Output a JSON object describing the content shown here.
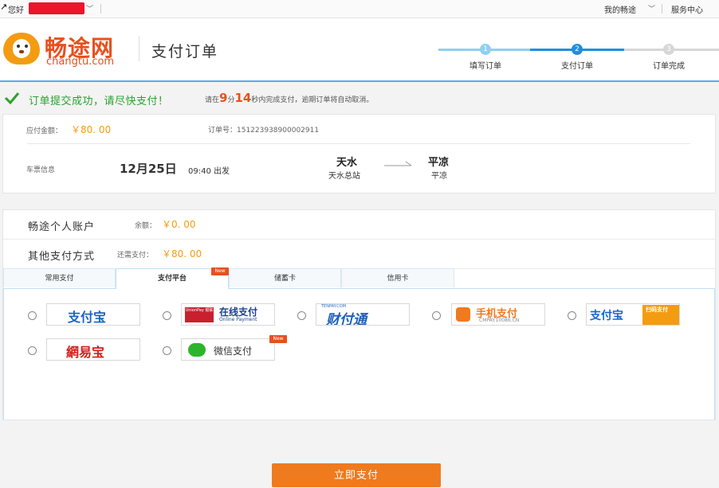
{
  "topbar": {
    "greeting": "您好",
    "my_changtu": "我的畅途",
    "service_center": "服务中心"
  },
  "brand": {
    "name_cn": "畅途网",
    "name_en": "changtu.com",
    "page_title": "支付订单"
  },
  "steps": [
    {
      "num": "1",
      "label": "填写订单"
    },
    {
      "num": "2",
      "label": "支付订单"
    },
    {
      "num": "3",
      "label": "订单完成"
    }
  ],
  "success": {
    "message": "订单提交成功，请尽快支付！",
    "countdown_prefix": "请在",
    "minutes": "9",
    "min_unit": "分",
    "seconds": "14",
    "countdown_suffix": "秒内完成支付，逾期订单将自动取消。"
  },
  "order": {
    "amount_label": "应付金额：",
    "amount": "￥80. 00",
    "order_no": "订单号：151223938900002911",
    "ticket_label": "车票信息",
    "date": "12月25日",
    "time": "09:40 出发",
    "from_city": "天水",
    "from_station": "天水总站",
    "to_city": "平凉",
    "to_station": "平凉"
  },
  "accounts": {
    "personal_label": "畅途个人账户",
    "balance_label": "余额：",
    "balance": "￥0. 00",
    "other_label": "其他支付方式",
    "need_label": "还需支付：",
    "need": "￥80. 00"
  },
  "tabs": [
    {
      "label": "常用支付"
    },
    {
      "label": "支付平台"
    },
    {
      "label": "储蓄卡"
    },
    {
      "label": "信用卡"
    }
  ],
  "new_badge": "New",
  "pay_methods": {
    "alipay": "支付宝",
    "unionpay_cn": "在线支付",
    "unionpay_en": "Online Payment",
    "unionpay_badge": "UnionPay 银联",
    "tenpay_top": "TENPAY.COM",
    "tenpay": "财付通",
    "cmpay": "手机支付",
    "cmpay_url": "CMPAY.10086.CN",
    "alipay_scan_logo": "支付宝",
    "alipay_scan_tag": "扫码支付",
    "netease": "網易宝",
    "wechat": "微信支付"
  },
  "pay_button": "立即支付",
  "colors": {
    "brand_orange": "#e8501e",
    "amount_orange": "#f39c12",
    "success_green": "#2aa32e",
    "step_blue": "#1e8fdc",
    "button_orange": "#f07a1e"
  }
}
